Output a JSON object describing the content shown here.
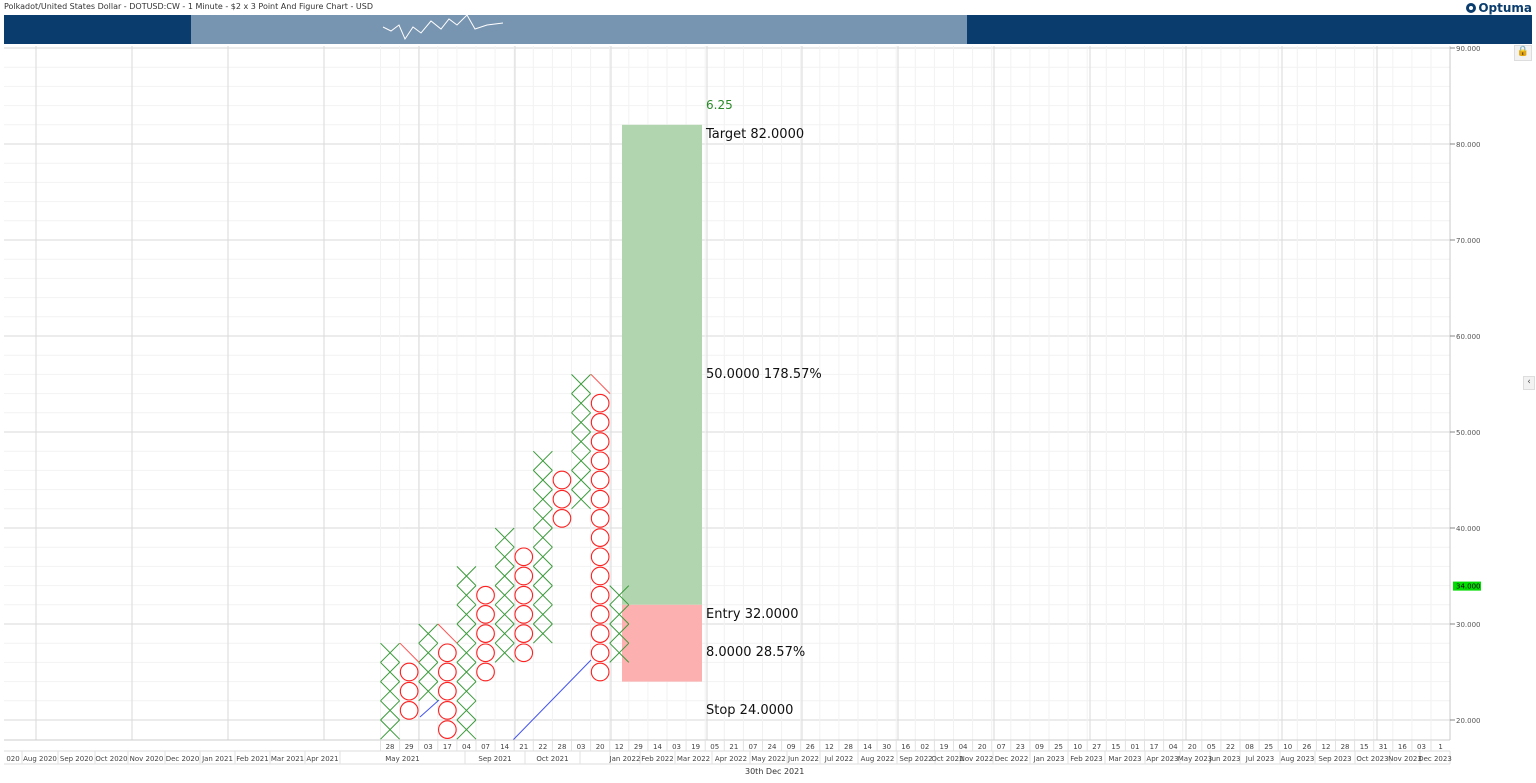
{
  "header": {
    "title": "Polkadot/United States Dollar - DOTUSD:CW - 1 Minute - $2 x 3 Point And Figure Chart - USD",
    "logo": "Optuma"
  },
  "footer": {
    "cursor_date": "30th Dec 2021"
  },
  "chart_data": {
    "type": "point-and-figure",
    "box_size": 2,
    "reversal": 3,
    "ylim": [
      18,
      90
    ],
    "yticks": [
      90,
      80,
      70,
      60,
      50,
      40,
      30,
      20
    ],
    "ytick_labels": [
      "90.000",
      "80.000",
      "70.000",
      "60.000",
      "50.000",
      "40.000",
      "30.000",
      "20.000"
    ],
    "current_price": "34.000",
    "columns": [
      {
        "type": "X",
        "low": 18,
        "high": 28
      },
      {
        "type": "O",
        "low": 20,
        "high": 26
      },
      {
        "type": "X",
        "low": 22,
        "high": 30
      },
      {
        "type": "O",
        "low": 16,
        "high": 28
      },
      {
        "type": "X",
        "low": 18,
        "high": 36
      },
      {
        "type": "O",
        "low": 24,
        "high": 34
      },
      {
        "type": "X",
        "low": 26,
        "high": 40
      },
      {
        "type": "O",
        "low": 26,
        "high": 38
      },
      {
        "type": "X",
        "low": 28,
        "high": 48
      },
      {
        "type": "O",
        "low": 40,
        "high": 46
      },
      {
        "type": "X",
        "low": 42,
        "high": 56
      },
      {
        "type": "O",
        "low": 24,
        "high": 54
      },
      {
        "type": "X",
        "low": 26,
        "high": 34
      }
    ],
    "trade": {
      "target": 82,
      "entry": 32,
      "stop": 24,
      "ratio": "6.25",
      "target_label": "Target  82.0000",
      "reward_label": "50.0000   178.57%",
      "entry_label": "Entry  32.0000",
      "risk_label": "8.0000   28.57%",
      "stop_label": "Stop  24.0000"
    },
    "x_day_labels": [
      "28",
      "29",
      "03",
      "17",
      "04",
      "07",
      "14",
      "21",
      "22",
      "28",
      "03",
      "20",
      "12",
      "29",
      "14",
      "03",
      "19",
      "05",
      "21",
      "07",
      "24",
      "09",
      "26",
      "12",
      "28",
      "14",
      "30",
      "16",
      "02",
      "19",
      "04",
      "20",
      "07",
      "23",
      "09",
      "25",
      "10",
      "27",
      "15",
      "01",
      "17",
      "04",
      "20",
      "05",
      "22",
      "08",
      "25",
      "10",
      "26",
      "12",
      "28",
      "15",
      "31",
      "16",
      "03",
      "1"
    ],
    "x_month_labels": [
      "020",
      "Aug 2020",
      "Sep 2020",
      "Oct 2020",
      "Nov 2020",
      "Dec 2020",
      "Jan 2021",
      "Feb 2021",
      "Mar 2021",
      "Apr 2021",
      "May 2021",
      "Sep 2021",
      "Oct 2021",
      "",
      "Jan 2022",
      "Feb 2022",
      "Mar 2022",
      "Apr 2022",
      "May 2022",
      "Jun 2022",
      "Jul 2022",
      "Aug 2022",
      "Sep 2022",
      "Oct 2022",
      "Nov 2022",
      "Dec 2022",
      "Jan 2023",
      "Feb 2023",
      "Mar 2023",
      "Apr 2023",
      "May 2023",
      "Jun 2023",
      "Jul 2023",
      "Aug 2023",
      "Sep 2023",
      "Oct 2023",
      "Nov 2023",
      "Dec 2023"
    ],
    "colors": {
      "x": "#3a9a3a",
      "o": "#ff2020",
      "reward": "#b1d6af",
      "risk": "#fdb0b0",
      "nav": "#0a3d6e",
      "price_tag": "#00dd00"
    }
  }
}
